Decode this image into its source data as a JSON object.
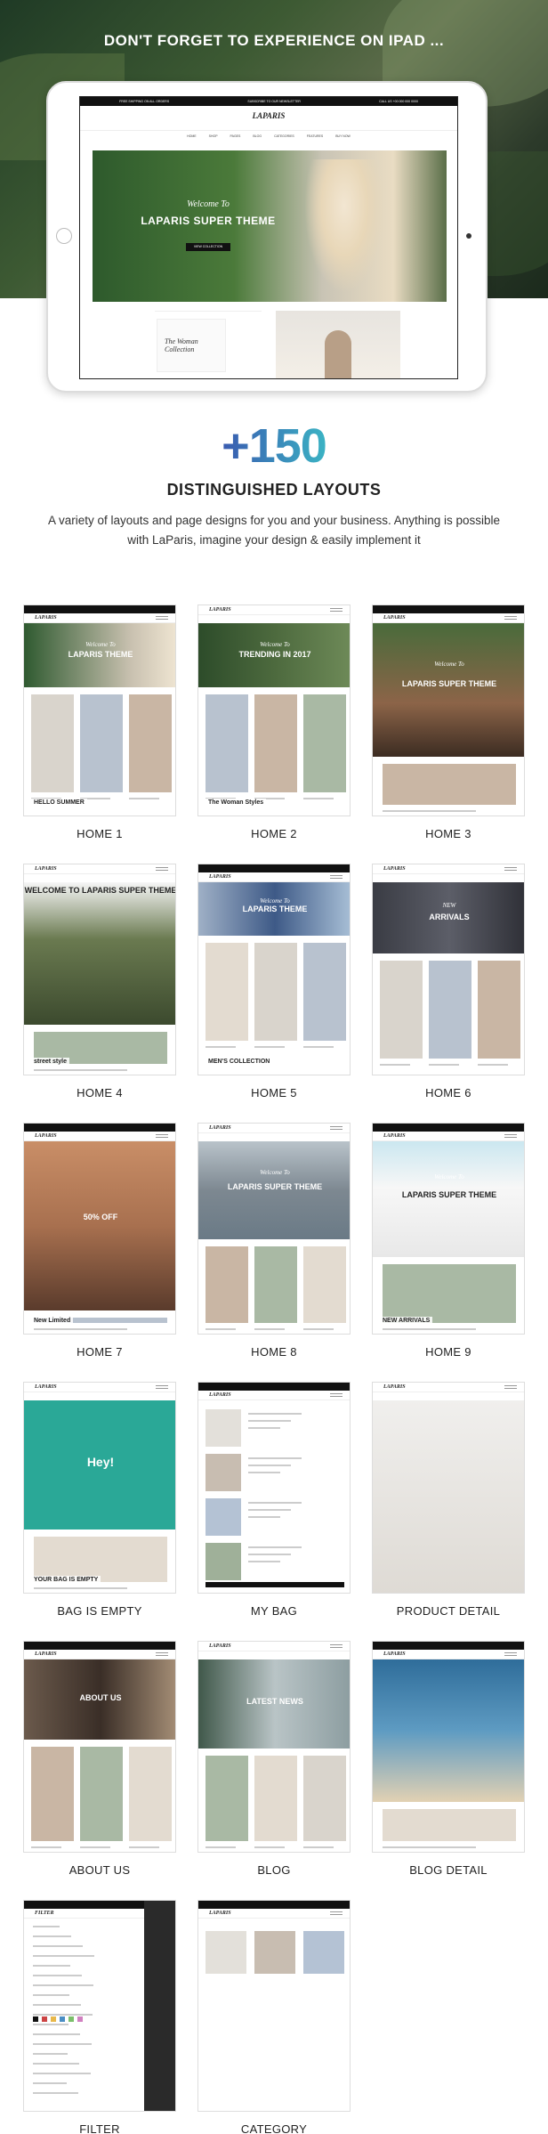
{
  "hero": {
    "title": "DON'T FORGET TO EXPERIENCE ON IPAD ...",
    "screen": {
      "logo": "LAPARIS",
      "top_bar": [
        "FREE SHIPPING ON ALL ORDERS",
        "SUBSCRIBE TO OUR NEWSLETTER",
        "CALL US +00 000 000 0000"
      ],
      "nav": [
        "HOME",
        "SHOP",
        "PAGES",
        "BLOG",
        "CATEGORIES",
        "FEATURES",
        "BUY NOW"
      ],
      "welcome": "Welcome To",
      "headline": "LAPARIS SUPER THEME",
      "button": "VIEW COLLECTION",
      "card": "The Woman Collection"
    }
  },
  "intro": {
    "count": "+150",
    "title": "DISTINGUISHED LAYOUTS",
    "description_line1": "A variety of layouts and page designs for you and your business. Anything is possible",
    "description_line2": "with LaParis, imagine  your design & easily implement it"
  },
  "layouts": [
    {
      "caption": "HOME 1",
      "logo": "LAPARIS",
      "headline": "LAPARIS THEME",
      "welcome": "Welcome To",
      "sub": "HELLO SUMMER"
    },
    {
      "caption": "HOME 2",
      "logo": "LAPARIS",
      "headline": "TRENDING IN 2017",
      "welcome": "Welcome To",
      "sub": "The Woman Styles"
    },
    {
      "caption": "HOME 3",
      "logo": "LAPARIS",
      "headline": "LAPARIS SUPER THEME",
      "welcome": "Welcome To",
      "sub": ""
    },
    {
      "caption": "HOME 4",
      "logo": "LAPARIS",
      "headline": "WELCOME TO LAPARIS SUPER THEME",
      "welcome": "",
      "sub": "street style"
    },
    {
      "caption": "HOME 5",
      "logo": "LAPARIS",
      "headline": "LAPARIS THEME",
      "welcome": "Welcome To",
      "sub": "MEN'S COLLECTION"
    },
    {
      "caption": "HOME 6",
      "logo": "LAPARIS",
      "headline": "ARRIVALS",
      "welcome": "NEW",
      "sub": ""
    },
    {
      "caption": "HOME 7",
      "logo": "LAPARIS",
      "headline": "50% OFF",
      "welcome": "",
      "sub": "New Limited"
    },
    {
      "caption": "HOME 8",
      "logo": "LAPARIS",
      "headline": "LAPARIS SUPER THEME",
      "welcome": "Welcome To",
      "sub": ""
    },
    {
      "caption": "HOME 9",
      "logo": "LAPARIS",
      "headline": "LAPARIS SUPER THEME",
      "welcome": "Welcome To",
      "sub": "NEW ARRIVALS"
    },
    {
      "caption": "BAG IS EMPTY",
      "logo": "LAPARIS",
      "headline": "Hey!",
      "welcome": "",
      "sub": "YOUR BAG IS EMPTY"
    },
    {
      "caption": "MY BAG",
      "logo": "LAPARIS",
      "headline": "",
      "welcome": "",
      "sub": ""
    },
    {
      "caption": "PRODUCT DETAIL",
      "logo": "LAPARIS",
      "headline": "",
      "welcome": "",
      "sub": ""
    },
    {
      "caption": "ABOUT US",
      "logo": "LAPARIS",
      "headline": "ABOUT US",
      "welcome": "",
      "sub": ""
    },
    {
      "caption": "BLOG",
      "logo": "LAPARIS",
      "headline": "LATEST NEWS",
      "welcome": "",
      "sub": ""
    },
    {
      "caption": "BLOG DETAIL",
      "logo": "LAPARIS",
      "headline": "",
      "welcome": "",
      "sub": ""
    },
    {
      "caption": "FILTER",
      "logo": "FILTER",
      "headline": "",
      "welcome": "",
      "sub": ""
    },
    {
      "caption": "CATEGORY",
      "logo": "LAPARIS",
      "headline": "",
      "welcome": "",
      "sub": ""
    }
  ]
}
